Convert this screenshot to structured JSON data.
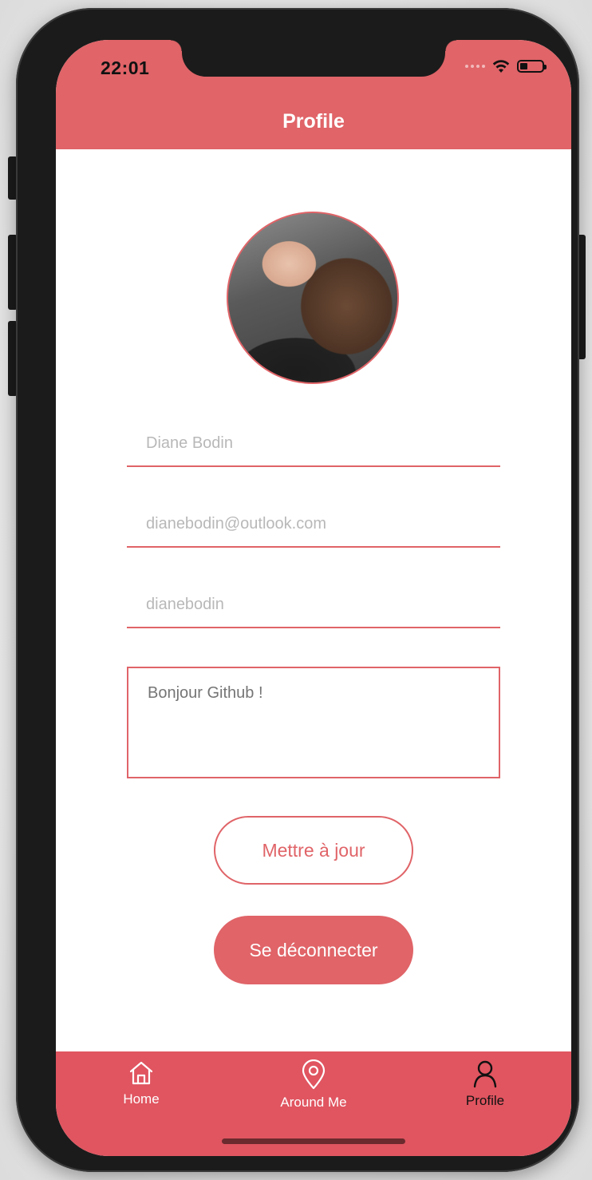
{
  "status_bar": {
    "time": "22:01",
    "icons": [
      "cellular-dots-icon",
      "wifi-icon",
      "battery-icon"
    ]
  },
  "header": {
    "title": "Profile"
  },
  "profile": {
    "avatar_alt": "profile photo",
    "name_placeholder": "Diane Bodin",
    "email_placeholder": "dianebodin@outlook.com",
    "username_placeholder": "dianebodin",
    "bio_placeholder": "Bonjour Github !"
  },
  "actions": {
    "update_label": "Mettre à jour",
    "logout_label": "Se déconnecter"
  },
  "tabbar": {
    "items": [
      {
        "label": "Home",
        "icon": "home-icon",
        "active": false
      },
      {
        "label": "Around Me",
        "icon": "map-pin-icon",
        "active": false
      },
      {
        "label": "Profile",
        "icon": "user-icon",
        "active": true
      }
    ]
  },
  "colors": {
    "accent": "#e06468",
    "tabbar": "#e05560",
    "active_tab_text": "#111111",
    "placeholder": "#b8b8b8"
  }
}
